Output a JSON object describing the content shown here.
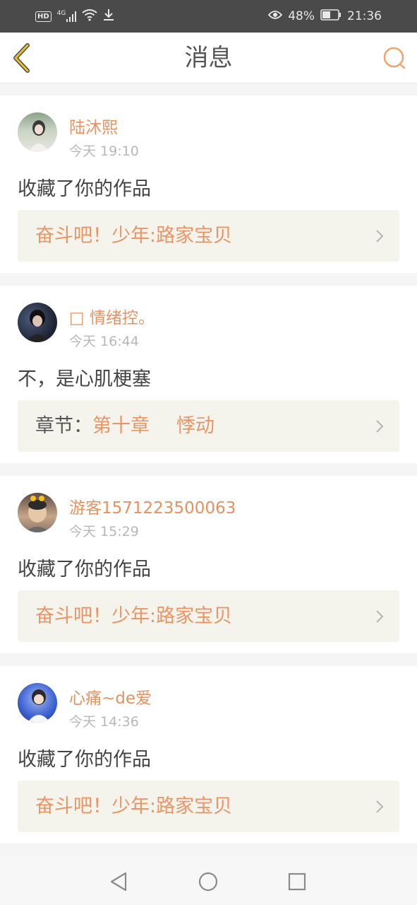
{
  "status_bar": {
    "hd": "HD",
    "network": "4G",
    "battery": "48%",
    "time": "21:36"
  },
  "header": {
    "title": "消息"
  },
  "messages": [
    {
      "user": "陆沐熙",
      "time": "今天 19:10",
      "text": "收藏了你的作品",
      "ref_prefix": "",
      "ref_part1": "奋斗吧！少年:路家宝贝",
      "ref_part2": ""
    },
    {
      "user": "□ 情绪控。",
      "time": "今天 16:44",
      "text": "不，是心肌梗塞",
      "ref_prefix": "章节：",
      "ref_part1": "第十章",
      "ref_part2": "悸动"
    },
    {
      "user": "游客1571223500063",
      "time": "今天 15:29",
      "text": "收藏了你的作品",
      "ref_prefix": "",
      "ref_part1": "奋斗吧！少年:路家宝贝",
      "ref_part2": ""
    },
    {
      "user": "心痛~de爱",
      "time": "今天 14:36",
      "text": "收藏了你的作品",
      "ref_prefix": "",
      "ref_part1": "奋斗吧！少年:路家宝贝",
      "ref_part2": ""
    }
  ],
  "colors": {
    "accent": "#e8915e",
    "back_icon": "#e8c12a",
    "ref_background": "#f4f3ec"
  },
  "icons": {
    "back": "chevron-left-icon",
    "search": "search-icon",
    "nav_back": "triangle-back-icon",
    "nav_home": "circle-home-icon",
    "nav_recent": "square-recent-icon"
  }
}
